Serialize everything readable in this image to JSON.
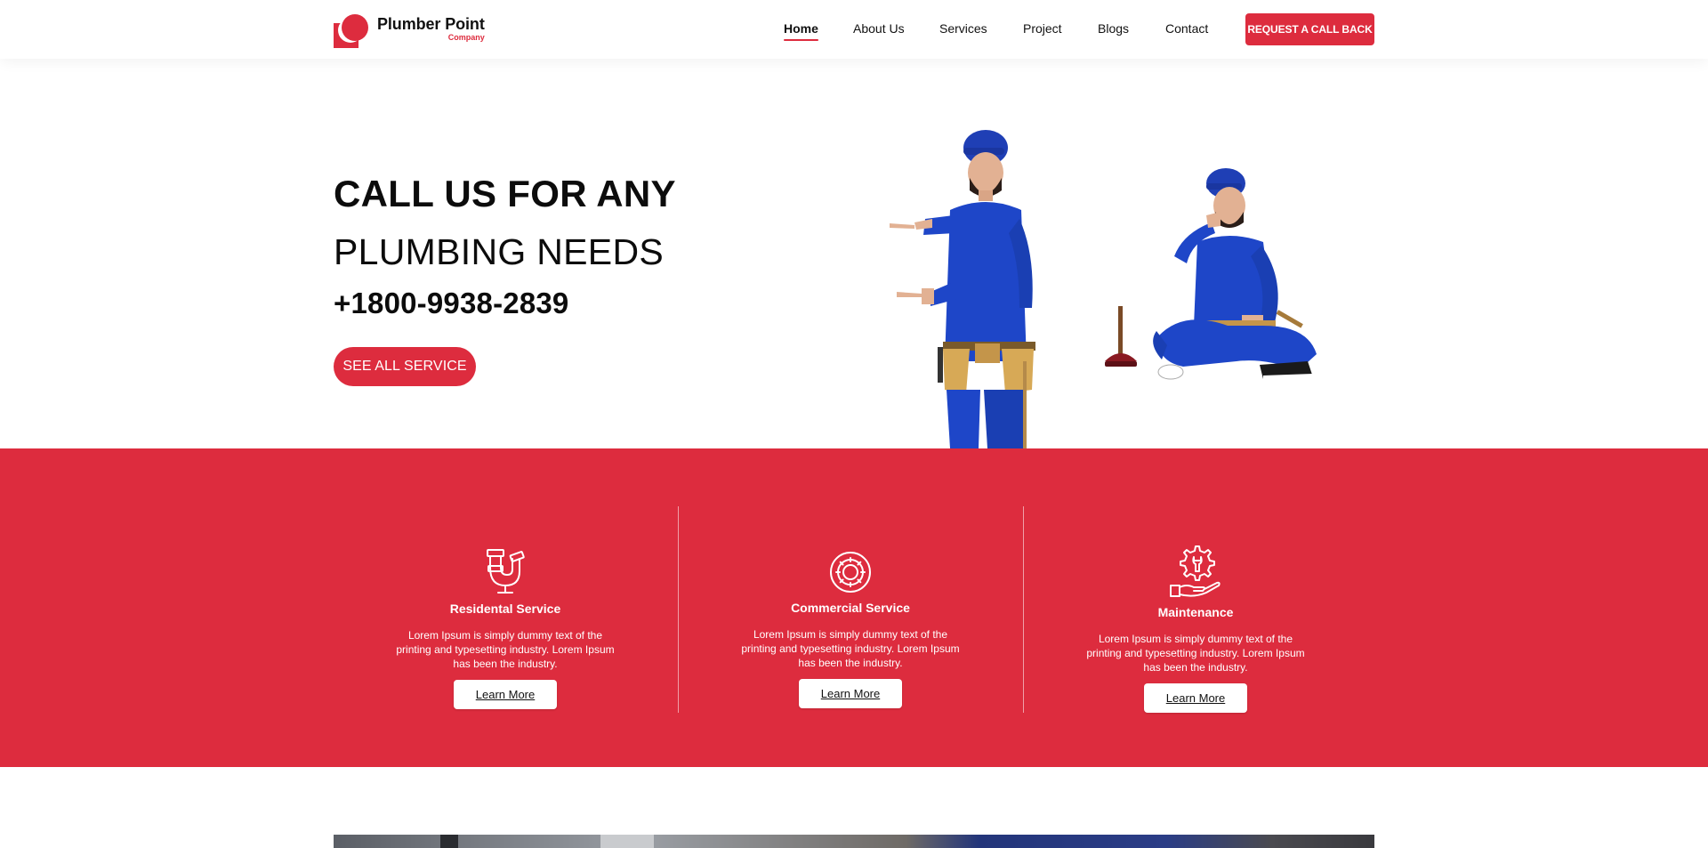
{
  "brand": {
    "name": "Plumber Point",
    "sub": "Company",
    "accent": "#dd2c3e"
  },
  "nav": {
    "items": [
      {
        "label": "Home",
        "active": true
      },
      {
        "label": "About Us"
      },
      {
        "label": "Services"
      },
      {
        "label": "Project"
      },
      {
        "label": "Blogs"
      },
      {
        "label": "Contact"
      }
    ],
    "cta_label": "REQUEST A CALL BACK"
  },
  "hero": {
    "line1": "CALL US FOR ANY",
    "line2": "PLUMBING NEEDS",
    "phone": "+1800-9938-2839",
    "button_label": "SEE ALL SERVICE"
  },
  "services": [
    {
      "icon": "pipe-icon",
      "title": "Residental Service",
      "description": "Lorem Ipsum is simply dummy text of the printing and typesetting industry. Lorem Ipsum has been the industry.",
      "button_label": "Learn More"
    },
    {
      "icon": "gear-icon",
      "title": "Commercial Service",
      "description": "Lorem Ipsum is simply dummy text of the printing and typesetting industry. Lorem Ipsum has been the industry.",
      "button_label": "Learn More"
    },
    {
      "icon": "wrench-hand-icon",
      "title": "Maintenance",
      "description": "Lorem Ipsum is simply dummy text of the printing and typesetting industry. Lorem Ipsum has been the industry.",
      "button_label": "Learn More"
    }
  ]
}
